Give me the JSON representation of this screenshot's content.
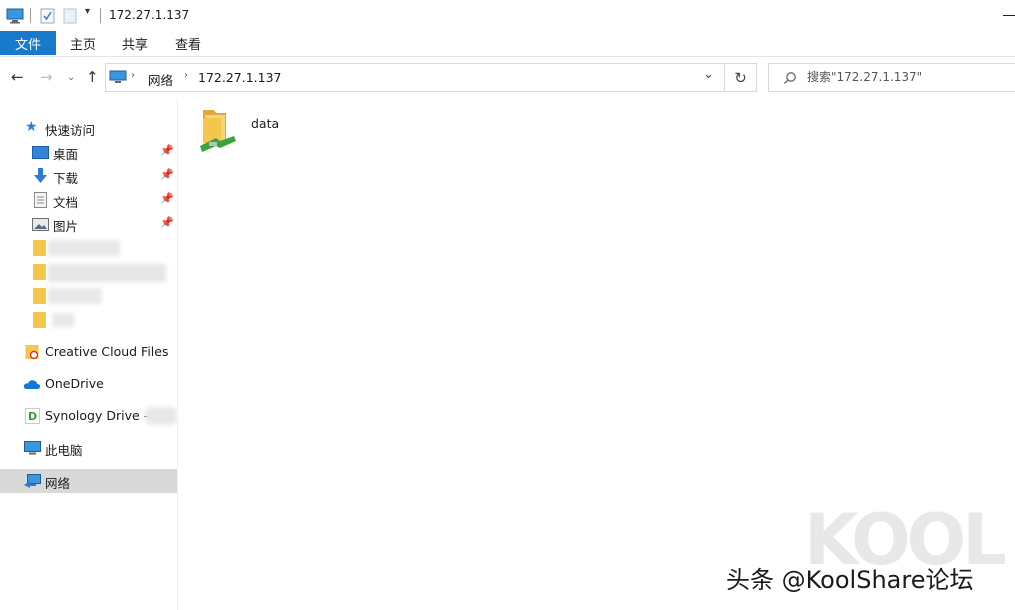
{
  "window": {
    "title": "172.27.1.137"
  },
  "ribbon": {
    "tabs": [
      "文件",
      "主页",
      "共享",
      "查看"
    ]
  },
  "address": {
    "path": [
      "网络",
      "172.27.1.137"
    ]
  },
  "search": {
    "placeholder": "搜索\"172.27.1.137\""
  },
  "sidebar": {
    "quick_access": "快速访问",
    "pinned": [
      "桌面",
      "下载",
      "文档",
      "图片"
    ],
    "creative_cloud": "Creative Cloud Files",
    "onedrive": "OneDrive",
    "synology": "Synology Drive - ",
    "this_pc": "此电脑",
    "network": "网络"
  },
  "content": {
    "items": [
      {
        "name": "data",
        "type": "shared-folder"
      }
    ]
  },
  "watermark": {
    "text": "头条 @KoolShare论坛",
    "logo_text": "KOOL"
  },
  "colors": {
    "accent": "#1979ca",
    "selected": "#d9d9d9",
    "folder": "#f4c64c"
  }
}
